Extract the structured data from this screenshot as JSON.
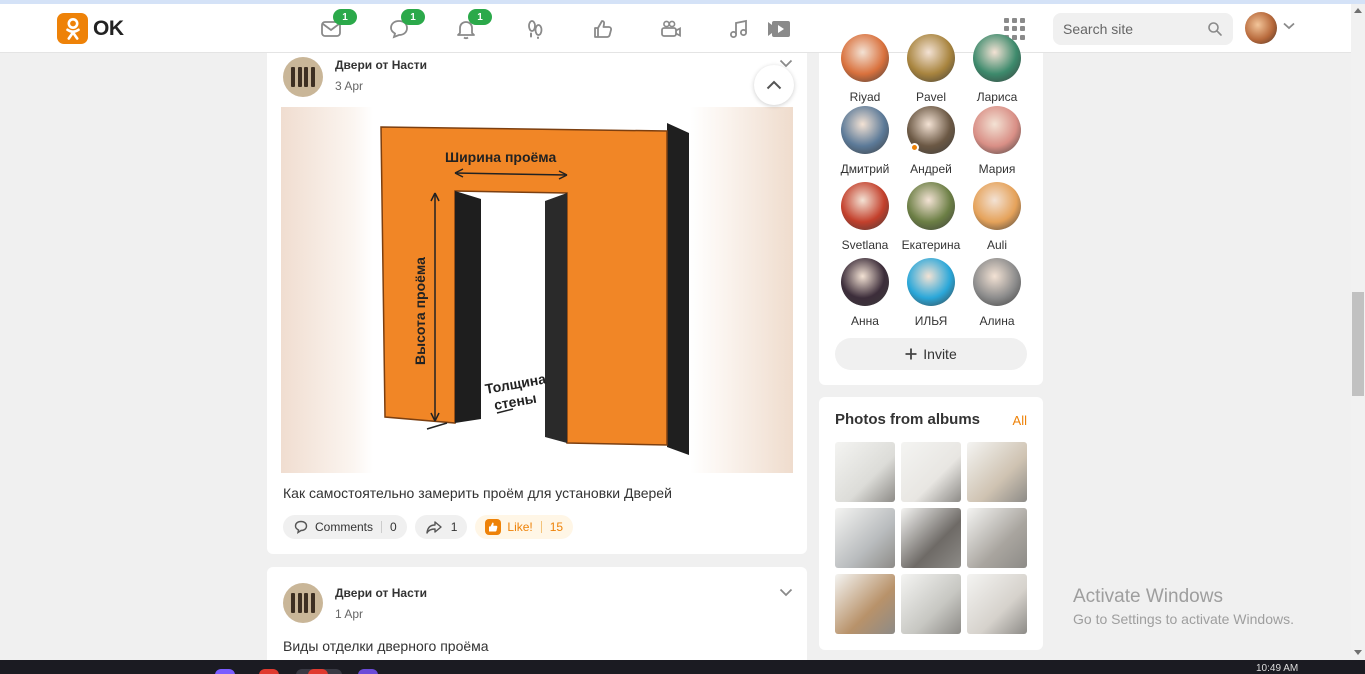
{
  "header": {
    "logo_text": "OK",
    "nav": [
      {
        "icon": "mail-icon",
        "badge": "1"
      },
      {
        "icon": "discussions-icon",
        "badge": "1"
      },
      {
        "icon": "notifications-icon",
        "badge": "1"
      },
      {
        "icon": "guests-icon"
      },
      {
        "icon": "reactions-icon"
      },
      {
        "icon": "video-camera-icon"
      },
      {
        "icon": "music-note-icon"
      },
      {
        "icon": "video-play-icon"
      }
    ],
    "search_placeholder": "Search site"
  },
  "feed": {
    "posts": [
      {
        "author": "Двери от Насти",
        "date": "3 Apr",
        "text": "Как самостоятельно замерить проём для установки Дверей",
        "image_labels": {
          "width": "Ширина проёма",
          "height": "Высота проёма",
          "thickness_line1": "Толщина",
          "thickness_line2": "стены"
        },
        "comments_label": "Comments",
        "comments_count": "0",
        "shares_count": "1",
        "like_label": "Like!",
        "likes_count": "15"
      },
      {
        "author": "Двери от Насти",
        "date": "1 Apr",
        "text": "Виды отделки дверного проёма"
      }
    ]
  },
  "friends": {
    "items": [
      {
        "name": "Riyad",
        "color": "#d9713d"
      },
      {
        "name": "Pavel",
        "color": "#a8843e"
      },
      {
        "name": "Лариса",
        "color": "#3d8a6c"
      },
      {
        "name": "Дмитрий",
        "color": "#5c7a98"
      },
      {
        "name": "Андрей",
        "color": "#6b5844",
        "online": true
      },
      {
        "name": "Мария",
        "color": "#d98f86"
      },
      {
        "name": "Svetlana",
        "color": "#c3402c"
      },
      {
        "name": "Екатерина",
        "color": "#6c7f45"
      },
      {
        "name": "Auli",
        "color": "#e5a25a"
      },
      {
        "name": "Анна",
        "color": "#3c2d3a"
      },
      {
        "name": "ИЛЬЯ",
        "color": "#2aa7d9"
      },
      {
        "name": "Алина",
        "color": "#8c8c8c"
      }
    ],
    "invite_label": "Invite"
  },
  "photos": {
    "title": "Photos from albums",
    "all_label": "All",
    "thumbs": [
      {
        "color": "#dcdcd8"
      },
      {
        "color": "#e8e6e2"
      },
      {
        "color": "#cfc3b2"
      },
      {
        "color": "#b9bcbe"
      },
      {
        "color": "#6e6a66"
      },
      {
        "color": "#a9a59f"
      },
      {
        "color": "#b8926a"
      },
      {
        "color": "#c7c7c2"
      },
      {
        "color": "#d6d2cc"
      }
    ]
  },
  "windows": {
    "activate_title": "Activate Windows",
    "activate_sub": "Go to Settings to activate Windows.",
    "clock": "10:49 AM"
  }
}
